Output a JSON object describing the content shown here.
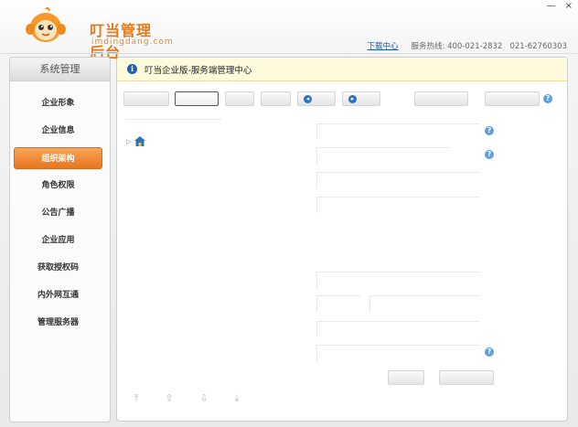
{
  "app": {
    "logo_text": "叮当管理后台",
    "logo_url": "imdingdang.com",
    "download_link": "下载中心",
    "hotline_label": "服务热线:",
    "hotline_1": "400-021-2832",
    "hotline_2": "021-62760303"
  },
  "window_controls": [
    "—",
    "×"
  ],
  "sidebar": {
    "title": "系统管理",
    "items": [
      {
        "label": "企业形象"
      },
      {
        "label": "企业信息"
      },
      {
        "label": "组织架构",
        "active": true
      },
      {
        "label": "角色权限"
      },
      {
        "label": "公告广播"
      },
      {
        "label": "企业应用"
      },
      {
        "label": "获取授权码"
      },
      {
        "label": "内外网互通"
      },
      {
        "label": "管理服务器"
      }
    ]
  },
  "main": {
    "title": "叮当企业版-服务端管理中心"
  },
  "toolbar": {
    "selected_index": 1
  },
  "icons": {
    "info": "info-icon",
    "help": "question-icon",
    "home": "home-icon",
    "tree_expand": "triangle-right-icon",
    "move_top": "arrow-top-icon",
    "move_up": "arrow-up-icon",
    "move_down": "arrow-down-icon",
    "move_bottom": "arrow-bottom-icon"
  },
  "colors": {
    "accent_orange": "#e8741f",
    "header_yellow": "#fdfbdc",
    "link_blue": "#1c5aa8",
    "help_blue": "#5aa0de"
  }
}
